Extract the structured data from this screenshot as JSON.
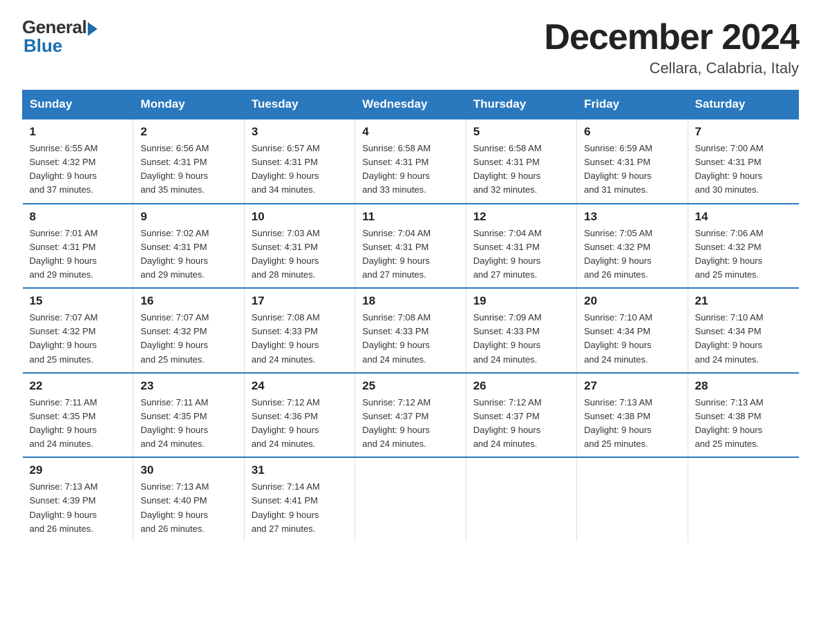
{
  "header": {
    "logo_general": "General",
    "logo_blue": "Blue",
    "month_title": "December 2024",
    "location": "Cellara, Calabria, Italy"
  },
  "days_of_week": [
    "Sunday",
    "Monday",
    "Tuesday",
    "Wednesday",
    "Thursday",
    "Friday",
    "Saturday"
  ],
  "weeks": [
    [
      {
        "day": "1",
        "sunrise": "6:55 AM",
        "sunset": "4:32 PM",
        "daylight": "9 hours and 37 minutes."
      },
      {
        "day": "2",
        "sunrise": "6:56 AM",
        "sunset": "4:31 PM",
        "daylight": "9 hours and 35 minutes."
      },
      {
        "day": "3",
        "sunrise": "6:57 AM",
        "sunset": "4:31 PM",
        "daylight": "9 hours and 34 minutes."
      },
      {
        "day": "4",
        "sunrise": "6:58 AM",
        "sunset": "4:31 PM",
        "daylight": "9 hours and 33 minutes."
      },
      {
        "day": "5",
        "sunrise": "6:58 AM",
        "sunset": "4:31 PM",
        "daylight": "9 hours and 32 minutes."
      },
      {
        "day": "6",
        "sunrise": "6:59 AM",
        "sunset": "4:31 PM",
        "daylight": "9 hours and 31 minutes."
      },
      {
        "day": "7",
        "sunrise": "7:00 AM",
        "sunset": "4:31 PM",
        "daylight": "9 hours and 30 minutes."
      }
    ],
    [
      {
        "day": "8",
        "sunrise": "7:01 AM",
        "sunset": "4:31 PM",
        "daylight": "9 hours and 29 minutes."
      },
      {
        "day": "9",
        "sunrise": "7:02 AM",
        "sunset": "4:31 PM",
        "daylight": "9 hours and 29 minutes."
      },
      {
        "day": "10",
        "sunrise": "7:03 AM",
        "sunset": "4:31 PM",
        "daylight": "9 hours and 28 minutes."
      },
      {
        "day": "11",
        "sunrise": "7:04 AM",
        "sunset": "4:31 PM",
        "daylight": "9 hours and 27 minutes."
      },
      {
        "day": "12",
        "sunrise": "7:04 AM",
        "sunset": "4:31 PM",
        "daylight": "9 hours and 27 minutes."
      },
      {
        "day": "13",
        "sunrise": "7:05 AM",
        "sunset": "4:32 PM",
        "daylight": "9 hours and 26 minutes."
      },
      {
        "day": "14",
        "sunrise": "7:06 AM",
        "sunset": "4:32 PM",
        "daylight": "9 hours and 25 minutes."
      }
    ],
    [
      {
        "day": "15",
        "sunrise": "7:07 AM",
        "sunset": "4:32 PM",
        "daylight": "9 hours and 25 minutes."
      },
      {
        "day": "16",
        "sunrise": "7:07 AM",
        "sunset": "4:32 PM",
        "daylight": "9 hours and 25 minutes."
      },
      {
        "day": "17",
        "sunrise": "7:08 AM",
        "sunset": "4:33 PM",
        "daylight": "9 hours and 24 minutes."
      },
      {
        "day": "18",
        "sunrise": "7:08 AM",
        "sunset": "4:33 PM",
        "daylight": "9 hours and 24 minutes."
      },
      {
        "day": "19",
        "sunrise": "7:09 AM",
        "sunset": "4:33 PM",
        "daylight": "9 hours and 24 minutes."
      },
      {
        "day": "20",
        "sunrise": "7:10 AM",
        "sunset": "4:34 PM",
        "daylight": "9 hours and 24 minutes."
      },
      {
        "day": "21",
        "sunrise": "7:10 AM",
        "sunset": "4:34 PM",
        "daylight": "9 hours and 24 minutes."
      }
    ],
    [
      {
        "day": "22",
        "sunrise": "7:11 AM",
        "sunset": "4:35 PM",
        "daylight": "9 hours and 24 minutes."
      },
      {
        "day": "23",
        "sunrise": "7:11 AM",
        "sunset": "4:35 PM",
        "daylight": "9 hours and 24 minutes."
      },
      {
        "day": "24",
        "sunrise": "7:12 AM",
        "sunset": "4:36 PM",
        "daylight": "9 hours and 24 minutes."
      },
      {
        "day": "25",
        "sunrise": "7:12 AM",
        "sunset": "4:37 PM",
        "daylight": "9 hours and 24 minutes."
      },
      {
        "day": "26",
        "sunrise": "7:12 AM",
        "sunset": "4:37 PM",
        "daylight": "9 hours and 24 minutes."
      },
      {
        "day": "27",
        "sunrise": "7:13 AM",
        "sunset": "4:38 PM",
        "daylight": "9 hours and 25 minutes."
      },
      {
        "day": "28",
        "sunrise": "7:13 AM",
        "sunset": "4:38 PM",
        "daylight": "9 hours and 25 minutes."
      }
    ],
    [
      {
        "day": "29",
        "sunrise": "7:13 AM",
        "sunset": "4:39 PM",
        "daylight": "9 hours and 26 minutes."
      },
      {
        "day": "30",
        "sunrise": "7:13 AM",
        "sunset": "4:40 PM",
        "daylight": "9 hours and 26 minutes."
      },
      {
        "day": "31",
        "sunrise": "7:14 AM",
        "sunset": "4:41 PM",
        "daylight": "9 hours and 27 minutes."
      },
      null,
      null,
      null,
      null
    ]
  ],
  "labels": {
    "sunrise_prefix": "Sunrise: ",
    "sunset_prefix": "Sunset: ",
    "daylight_prefix": "Daylight: "
  }
}
